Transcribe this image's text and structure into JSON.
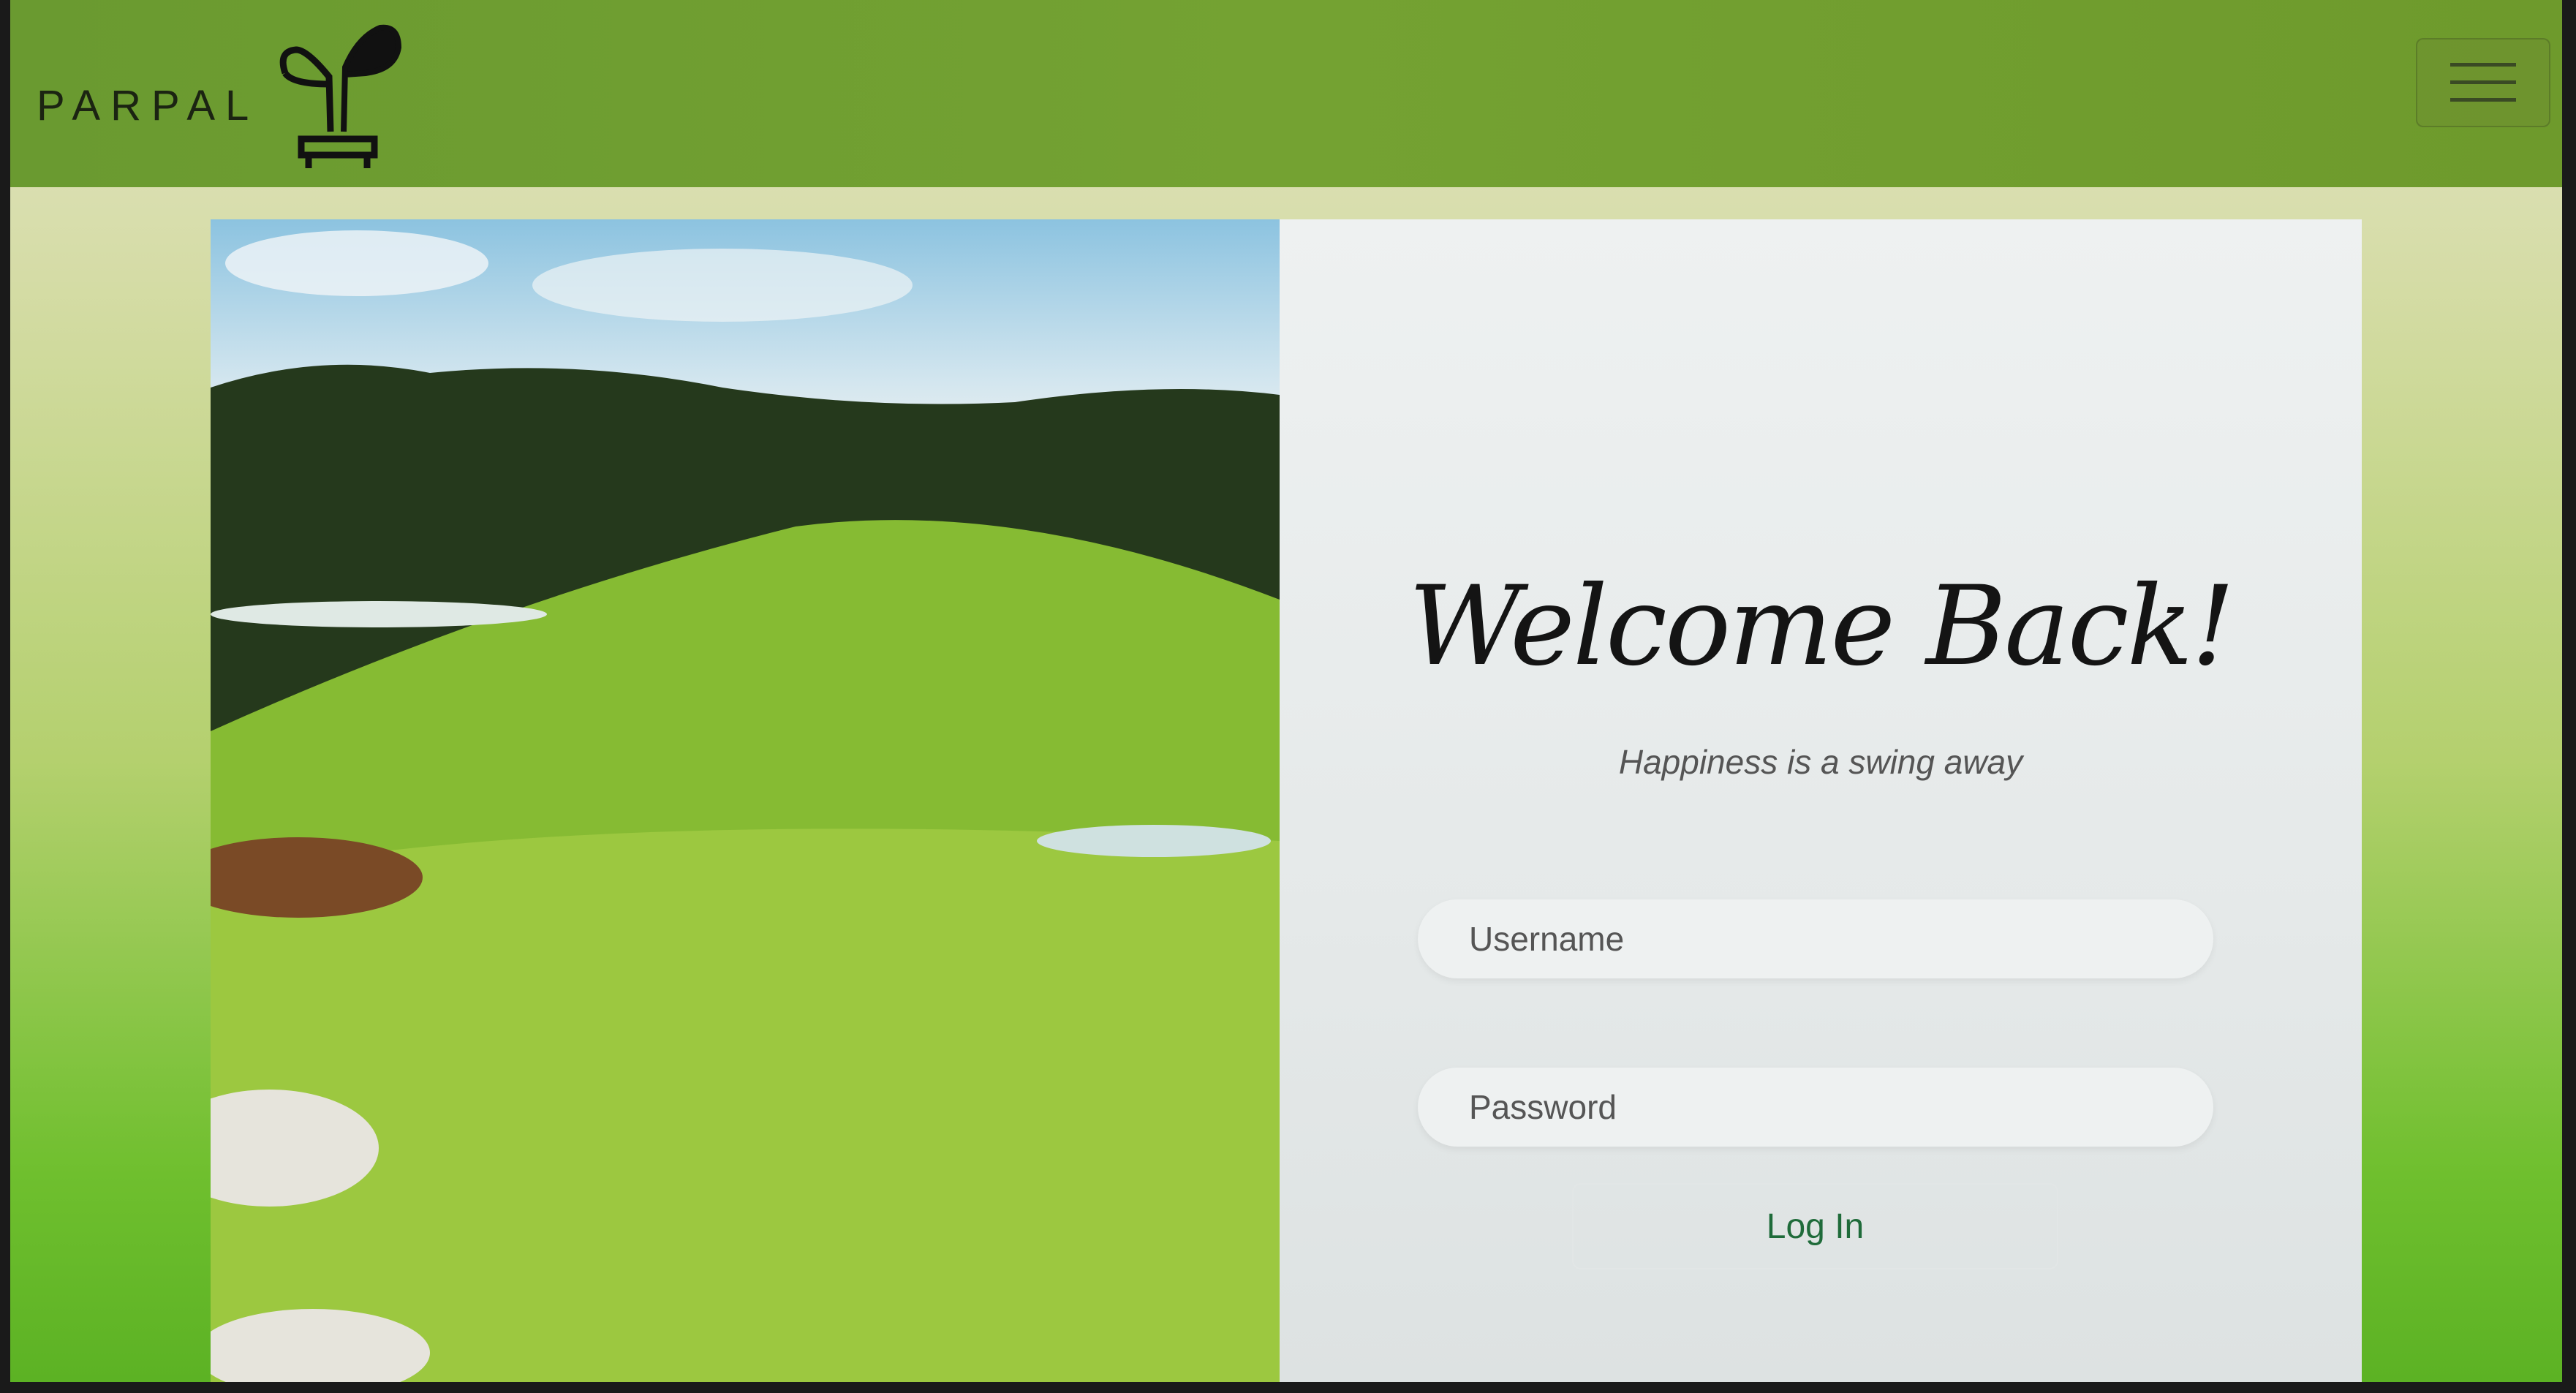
{
  "header": {
    "brand": "PARPAL",
    "menu_icon": "hamburger-icon"
  },
  "login": {
    "title": "Welcome Back!",
    "subtitle": "Happiness is a swing away",
    "username_placeholder": "Username",
    "password_placeholder": "Password",
    "submit_label": "Log In"
  },
  "colors": {
    "header": "#6e9a2e",
    "accent": "#1f6b3a"
  }
}
